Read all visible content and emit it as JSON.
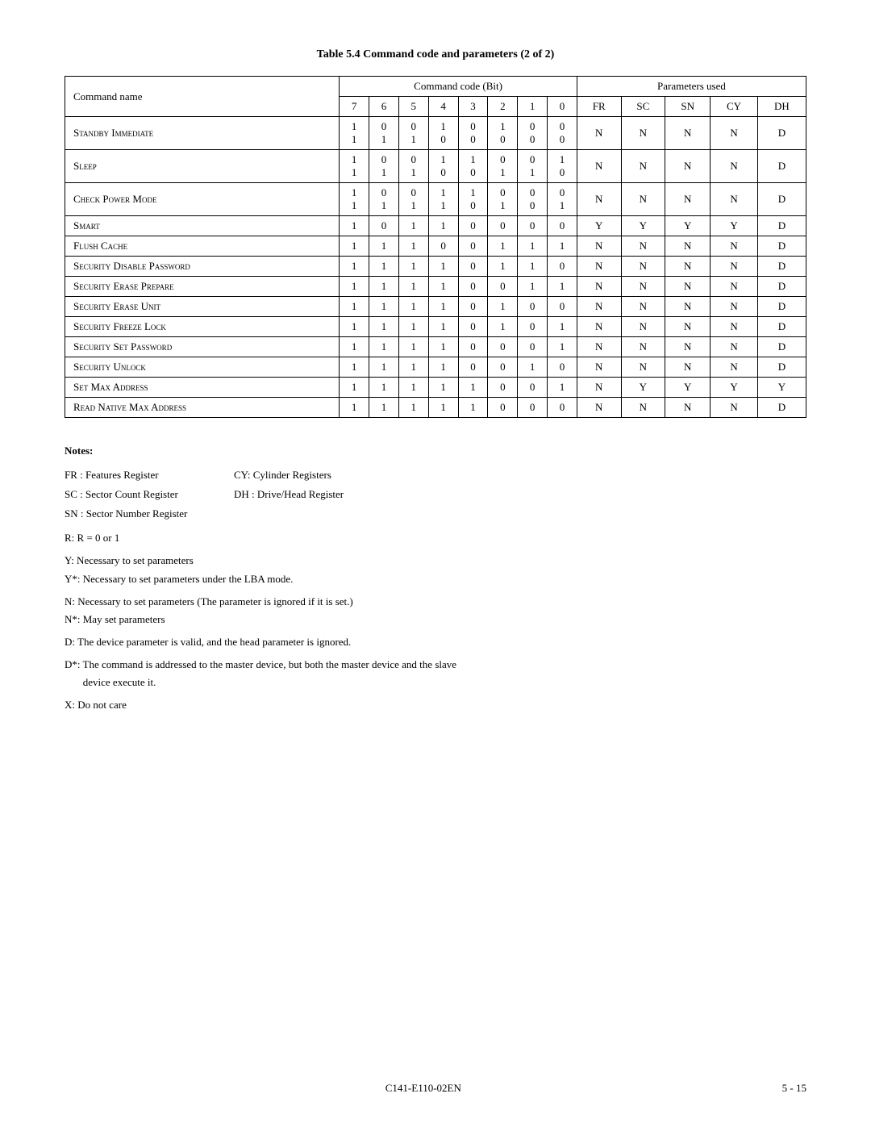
{
  "page": {
    "title": "Table 5.4    Command code and parameters (2 of 2)",
    "footer_center": "C141-E110-02EN",
    "footer_right": "5 - 15"
  },
  "table": {
    "header": {
      "row1_cmd_label": "Command name",
      "row1_code_label": "Command code (Bit)",
      "row1_params_label": "Parameters used",
      "row2_cols": [
        "7",
        "6",
        "5",
        "4",
        "3",
        "2",
        "1",
        "0",
        "FR",
        "SC",
        "SN",
        "CY",
        "DH"
      ]
    },
    "rows": [
      {
        "name": "Standby Immediate",
        "bits": [
          "1\n1",
          "0\n1",
          "0\n1",
          "1\n0",
          "0\n0",
          "1\n0",
          "0\n0",
          "0\n0"
        ],
        "params": [
          "N",
          "N",
          "N",
          "N",
          "D"
        ]
      },
      {
        "name": "Sleep",
        "bits": [
          "1\n1",
          "0\n1",
          "0\n1",
          "1\n0",
          "1\n0",
          "0\n1",
          "0\n1",
          "1\n0"
        ],
        "params": [
          "N",
          "N",
          "N",
          "N",
          "D"
        ]
      },
      {
        "name": "Check Power Mode",
        "bits": [
          "1\n1",
          "0\n1",
          "0\n1",
          "1\n1",
          "1\n0",
          "0\n1",
          "0\n0",
          "0\n1"
        ],
        "params": [
          "N",
          "N",
          "N",
          "N",
          "D"
        ]
      },
      {
        "name": "Smart",
        "bits": [
          "1",
          "0",
          "1",
          "1",
          "0",
          "0",
          "0",
          "0"
        ],
        "params": [
          "Y",
          "Y",
          "Y",
          "Y",
          "D"
        ]
      },
      {
        "name": "Flush Cache",
        "bits": [
          "1",
          "1",
          "1",
          "0",
          "0",
          "1",
          "1",
          "1"
        ],
        "params": [
          "N",
          "N",
          "N",
          "N",
          "D"
        ]
      },
      {
        "name": "Security Disable Password",
        "bits": [
          "1",
          "1",
          "1",
          "1",
          "0",
          "1",
          "1",
          "0"
        ],
        "params": [
          "N",
          "N",
          "N",
          "N",
          "D"
        ]
      },
      {
        "name": "Security Erase Prepare",
        "bits": [
          "1",
          "1",
          "1",
          "1",
          "0",
          "0",
          "1",
          "1"
        ],
        "params": [
          "N",
          "N",
          "N",
          "N",
          "D"
        ]
      },
      {
        "name": "Security Erase Unit",
        "bits": [
          "1",
          "1",
          "1",
          "1",
          "0",
          "1",
          "0",
          "0"
        ],
        "params": [
          "N",
          "N",
          "N",
          "N",
          "D"
        ]
      },
      {
        "name": "Security Freeze Lock",
        "bits": [
          "1",
          "1",
          "1",
          "1",
          "0",
          "1",
          "0",
          "1"
        ],
        "params": [
          "N",
          "N",
          "N",
          "N",
          "D"
        ]
      },
      {
        "name": "Security Set Password",
        "bits": [
          "1",
          "1",
          "1",
          "1",
          "0",
          "0",
          "0",
          "1"
        ],
        "params": [
          "N",
          "N",
          "N",
          "N",
          "D"
        ]
      },
      {
        "name": "Security Unlock",
        "bits": [
          "1",
          "1",
          "1",
          "1",
          "0",
          "0",
          "1",
          "0"
        ],
        "params": [
          "N",
          "N",
          "N",
          "N",
          "D"
        ]
      },
      {
        "name": "Set Max Address",
        "bits": [
          "1",
          "1",
          "1",
          "1",
          "1",
          "0",
          "0",
          "1"
        ],
        "params": [
          "N",
          "Y",
          "Y",
          "Y",
          "Y"
        ]
      },
      {
        "name": "Read Native Max Address",
        "bits": [
          "1",
          "1",
          "1",
          "1",
          "1",
          "0",
          "0",
          "0"
        ],
        "params": [
          "N",
          "N",
          "N",
          "N",
          "D"
        ]
      }
    ]
  },
  "notes": {
    "title": "Notes:",
    "legend": [
      {
        "abbr": "FR : Features Register",
        "full": "CY: Cylinder Registers"
      },
      {
        "abbr": "SC : Sector Count Register",
        "full": "DH : Drive/Head Register"
      },
      {
        "abbr": "SN : Sector Number Register",
        "full": ""
      }
    ],
    "items": [
      "R: R = 0 or 1",
      "Y:   Necessary to set parameters",
      "Y*: Necessary to set parameters under the LBA mode.",
      "N:   Necessary to set parameters (The parameter is ignored if it is set.)",
      "N*: May set parameters",
      "D:   The device parameter is valid, and the head parameter is ignored.",
      "D*: The command is addressed to the master device, but both the master device and the slave\n       device execute it.",
      "X:   Do not care"
    ]
  }
}
